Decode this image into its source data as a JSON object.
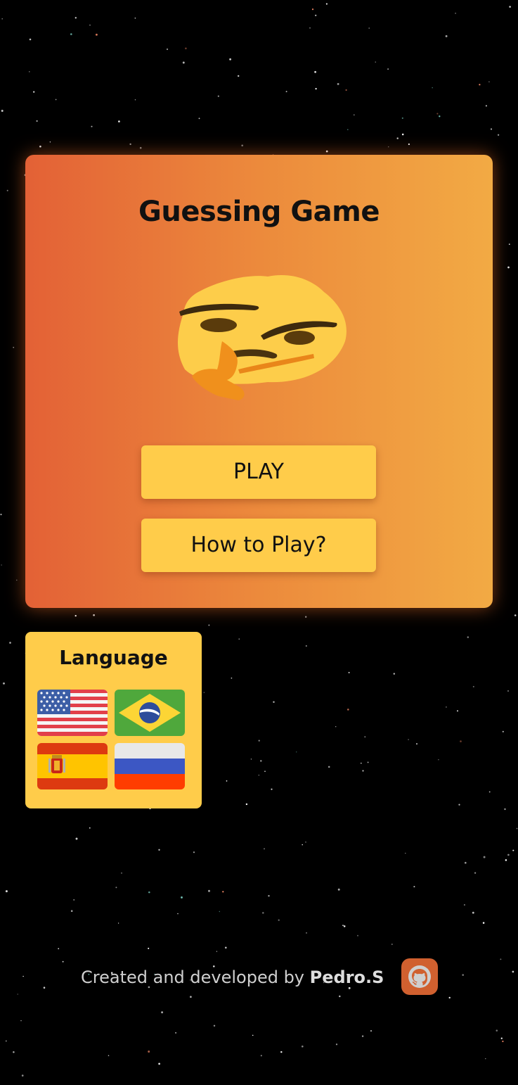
{
  "card": {
    "title": "Guessing Game",
    "emoji_icon": "thinking-face-icon",
    "play_label": "PLAY",
    "how_label": "How to Play?"
  },
  "language": {
    "title": "Language",
    "flags": [
      {
        "icon": "flag-usa-icon"
      },
      {
        "icon": "flag-brazil-icon"
      },
      {
        "icon": "flag-spain-icon"
      },
      {
        "icon": "flag-russia-icon"
      }
    ]
  },
  "footer": {
    "text": "Created and developed by",
    "author": "Pedro.S",
    "link_icon": "github-icon"
  },
  "colors": {
    "background": "#000000",
    "card_left": "#e36136",
    "card_right": "#f2aa44",
    "button": "#ffcc4a",
    "github_bg": "#d0602f"
  }
}
